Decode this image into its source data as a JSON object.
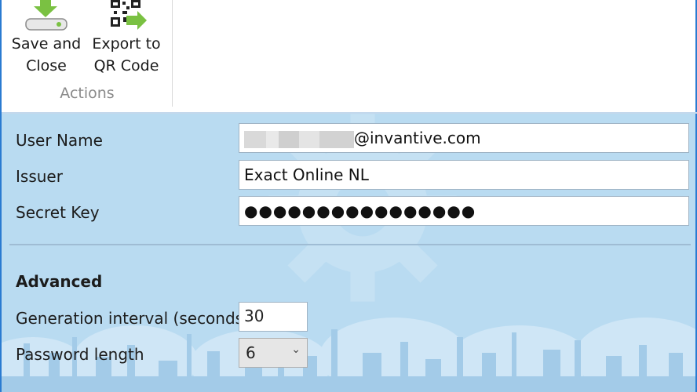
{
  "ribbon": {
    "save_and_close": {
      "line1": "Save and",
      "line2": "Close"
    },
    "export_qr": {
      "line1": "Export to",
      "line2": "QR Code"
    },
    "group_label": "Actions"
  },
  "form": {
    "user_name": {
      "label": "User Name",
      "value_suffix": "@invantive.com"
    },
    "issuer": {
      "label": "Issuer",
      "value": "Exact Online NL"
    },
    "secret_key": {
      "label": "Secret Key",
      "value": "●●●●●●●●●●●●●●●●"
    },
    "advanced": {
      "heading": "Advanced"
    },
    "generation_interval": {
      "label": "Generation interval (seconds)",
      "value": "30"
    },
    "password_length": {
      "label": "Password length",
      "value": "6"
    }
  },
  "colors": {
    "accent": "#2a7bd1",
    "panel": "#b9dbf1",
    "green": "#7ac142"
  }
}
